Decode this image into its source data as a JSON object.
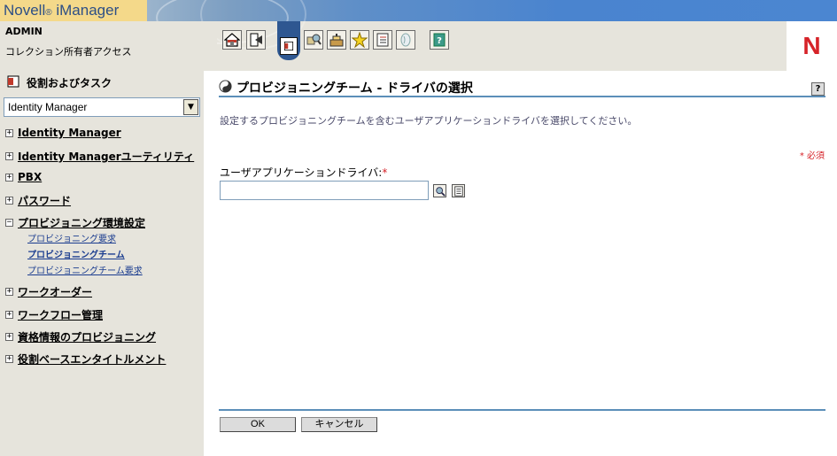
{
  "header": {
    "brand_prefix": "Novell",
    "brand_reg": "®",
    "brand_product": "iManager",
    "user": "ADMIN",
    "access": "コレクション所有者アクセス",
    "logo_letter": "N"
  },
  "toolbar": {
    "icons": [
      "home-icon",
      "exit-icon",
      "roles-tasks-icon",
      "view-objects-icon",
      "configure-icon",
      "favorites-icon",
      "preferences-icon",
      "mobile-icon",
      "help-book-icon"
    ],
    "active": "roles-tasks-icon"
  },
  "sidebar": {
    "title": "役割およびタスク",
    "selected_role": "Identity Manager",
    "categories": [
      {
        "label": "Identity Manager",
        "expanded": false
      },
      {
        "label": "Identity Managerユーティリティ",
        "expanded": false
      },
      {
        "label": "PBX",
        "expanded": false
      },
      {
        "label": "パスワード",
        "expanded": false
      },
      {
        "label": "プロビジョニング環境設定",
        "expanded": true,
        "children": [
          {
            "label": "プロビジョニング要求",
            "bold": false
          },
          {
            "label": "プロビジョニングチーム",
            "bold": true
          },
          {
            "label": "プロビジョニングチーム要求",
            "bold": false
          }
        ]
      },
      {
        "label": "ワークオーダー",
        "expanded": false
      },
      {
        "label": "ワークフロー管理",
        "expanded": false
      },
      {
        "label": "資格情報のプロビジョニング",
        "expanded": false
      },
      {
        "label": "役割ベースエンタイトルメント",
        "expanded": false
      }
    ]
  },
  "main": {
    "title": "プロビジョニングチーム - ドライバの選択",
    "help": "?",
    "description": "設定するプロビジョニングチームを含むユーザアプリケーションドライバを選択してください。",
    "required_note": "* 必須",
    "field_label": "ユーザアプリケーションドライバ:",
    "field_star": "*",
    "field_value": "",
    "ok_label": "OK",
    "cancel_label": "キャンセル"
  },
  "colors": {
    "accent_blue": "#5b8fb9",
    "required_red": "#d62329",
    "sidebar_bg": "#e6e4dc"
  }
}
